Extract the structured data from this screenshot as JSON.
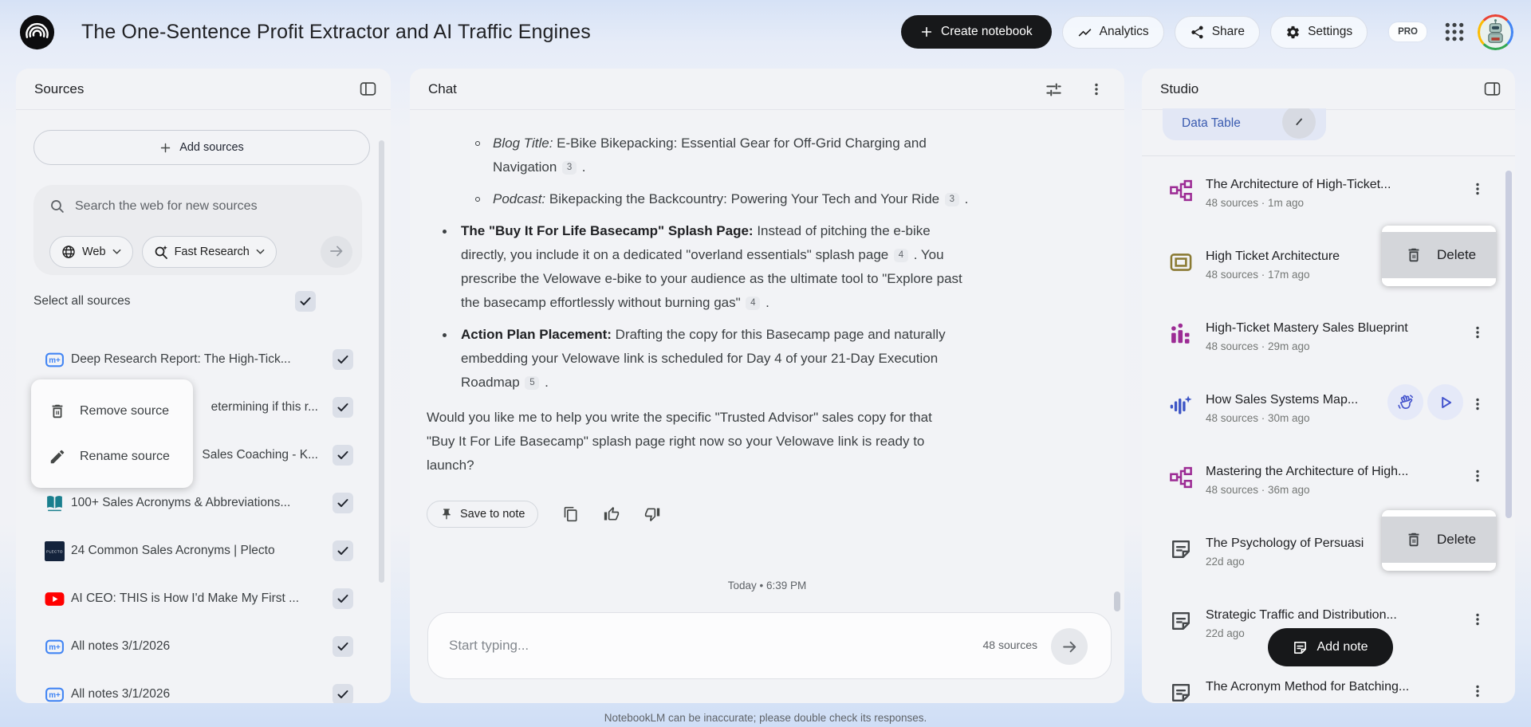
{
  "header": {
    "logo_icon": "notebooklm-logo",
    "title": "The One-Sentence Profit Extractor and AI Traffic Engines",
    "create_notebook": {
      "label": "Create notebook",
      "icon": "plus"
    },
    "analytics": {
      "label": "Analytics",
      "icon": "trending-up"
    },
    "share": {
      "label": "Share",
      "icon": "share-nodes"
    },
    "settings": {
      "label": "Settings",
      "icon": "gear"
    },
    "pro_badge": "PRO",
    "apps_icon": "apps-grid",
    "avatar_icon": "robot-avatar"
  },
  "sources_panel": {
    "title": "Sources",
    "collapse_icon": "panel-collapse-left",
    "add_button": {
      "label": "Add sources",
      "icon": "plus"
    },
    "search": {
      "placeholder": "Search the web for new sources",
      "icon": "magnifier"
    },
    "web_chip": {
      "label": "Web",
      "icon": "globe",
      "chevron_icon": "chevron-down"
    },
    "research_chip": {
      "label": "Fast Research",
      "icon": "sparkle-search",
      "chevron_icon": "chevron-down"
    },
    "submit_icon": "arrow-right",
    "select_all_label": "Select all sources",
    "checkbox_icon": "check",
    "items": [
      {
        "icon": "notebook-note",
        "title": "Deep Research Report: The High-Tick...",
        "checked": true,
        "occluded": false
      },
      {
        "icon": null,
        "title": "etermining if this r...",
        "checked": true,
        "occluded": true
      },
      {
        "icon": null,
        "title": "Sales Coaching - K...",
        "checked": true,
        "occluded": true
      },
      {
        "icon": "book",
        "title": "100+ Sales Acronyms & Abbreviations...",
        "checked": true,
        "occluded": false
      },
      {
        "icon": "plecto",
        "title": "24 Common Sales Acronyms | Plecto",
        "checked": true,
        "occluded": false
      },
      {
        "icon": "youtube",
        "title": "AI CEO: THIS is How I'd Make My First ...",
        "checked": true,
        "occluded": false
      },
      {
        "icon": "notebook-note",
        "title": "All notes 3/1/2026",
        "checked": true,
        "occluded": false
      },
      {
        "icon": "notebook-note",
        "title": "All notes 3/1/2026",
        "checked": true,
        "occluded": false
      }
    ],
    "context_menu": [
      {
        "icon": "trash",
        "label": "Remove source"
      },
      {
        "icon": "pencil",
        "label": "Rename source"
      }
    ]
  },
  "chat_panel": {
    "title": "Chat",
    "tune_icon": "tune",
    "menu_icon": "more-vert",
    "blocks": [
      {
        "type": "sub",
        "segments": [
          {
            "s": "i",
            "t": "Blog Title:"
          },
          {
            "s": "p",
            "t": " E-Bike Bikepacking: Essential Gear for Off-Grid Charging and Navigation "
          },
          {
            "s": "c",
            "t": "3"
          },
          {
            "s": "p",
            "t": " ."
          }
        ]
      },
      {
        "type": "sub",
        "segments": [
          {
            "s": "i",
            "t": "Podcast:"
          },
          {
            "s": "p",
            "t": " Bikepacking the Backcountry: Powering Your Tech and Your Ride "
          },
          {
            "s": "c",
            "t": "3"
          },
          {
            "s": "p",
            "t": " ."
          }
        ]
      },
      {
        "type": "bullet",
        "segments": [
          {
            "s": "b",
            "t": "The \"Buy It For Life Basecamp\" Splash Page:"
          },
          {
            "s": "p",
            "t": " Instead of pitching the e-bike directly, you include it on a dedicated \"overland essentials\" splash page "
          },
          {
            "s": "c",
            "t": "4"
          },
          {
            "s": "p",
            "t": " . You prescribe the Velowave e-bike to your audience as the ultimate tool to \"Explore past the basecamp effortlessly without burning gas\" "
          },
          {
            "s": "c",
            "t": "4"
          },
          {
            "s": "p",
            "t": " ."
          }
        ]
      },
      {
        "type": "bullet",
        "segments": [
          {
            "s": "b",
            "t": "Action Plan Placement:"
          },
          {
            "s": "p",
            "t": " Drafting the copy for this Basecamp page and naturally embedding your Velowave link is scheduled for Day 4 of your 21-Day Execution Roadmap "
          },
          {
            "s": "c",
            "t": "5"
          },
          {
            "s": "p",
            "t": " ."
          }
        ]
      },
      {
        "type": "para",
        "segments": [
          {
            "s": "p",
            "t": "Would you like me to help you write the specific \"Trusted Advisor\" sales copy for that \"Buy It For Life Basecamp\" splash page right now so your Velowave link is ready to launch?"
          }
        ]
      }
    ],
    "actions": {
      "save": {
        "label": "Save to note",
        "icon": "pin"
      },
      "copy_icon": "copy",
      "like_icon": "thumbs-up",
      "dislike_icon": "thumbs-down"
    },
    "session_divider": "Today • 6:39 PM",
    "input": {
      "placeholder": "Start typing...",
      "sources_count": "48 sources",
      "send_icon": "arrow-right"
    }
  },
  "studio_panel": {
    "title": "Studio",
    "collapse_icon": "panel-collapse-right",
    "chip": {
      "label": "Data Table",
      "icon": "diagonal-line"
    },
    "items": [
      {
        "icon": "flowchart",
        "color": "#9c2b94",
        "title": "The Architecture of High-Ticket...",
        "meta": "48 sources · 1m ago",
        "actions": []
      },
      {
        "icon": "frame",
        "color": "#8a7a33",
        "title": "High Ticket Architecture",
        "meta": "48 sources · 17m ago",
        "actions": []
      },
      {
        "icon": "barchart",
        "color": "#9c2b94",
        "title": "High-Ticket Mastery Sales Blueprint",
        "meta": "48 sources · 29m ago",
        "actions": []
      },
      {
        "icon": "waveform",
        "color": "#3d55c6",
        "title": "How Sales Systems Map...",
        "meta": "48 sources · 30m ago",
        "actions": [
          "hand-wave",
          "play"
        ]
      },
      {
        "icon": "flowchart",
        "color": "#9c2b94",
        "title": "Mastering the Architecture of High...",
        "meta": "48 sources · 36m ago",
        "actions": []
      },
      {
        "icon": "note",
        "color": "#45484b",
        "title": "The Psychology of Persuasi",
        "meta": "22d ago",
        "actions": []
      },
      {
        "icon": "note",
        "color": "#45484b",
        "title": "Strategic Traffic and Distribution...",
        "meta": "22d ago",
        "actions": []
      },
      {
        "icon": "note",
        "color": "#45484b",
        "title": "The Acronym Method for Batching...",
        "meta": "",
        "actions": []
      }
    ],
    "popups": [
      {
        "icon": "trash",
        "label": "Delete"
      },
      {
        "icon": "trash",
        "label": "Delete"
      }
    ],
    "add_note": {
      "label": "Add note",
      "icon": "note"
    }
  },
  "footer": {
    "disclaimer": "NotebookLM can be inaccurate; please double check its responses."
  }
}
